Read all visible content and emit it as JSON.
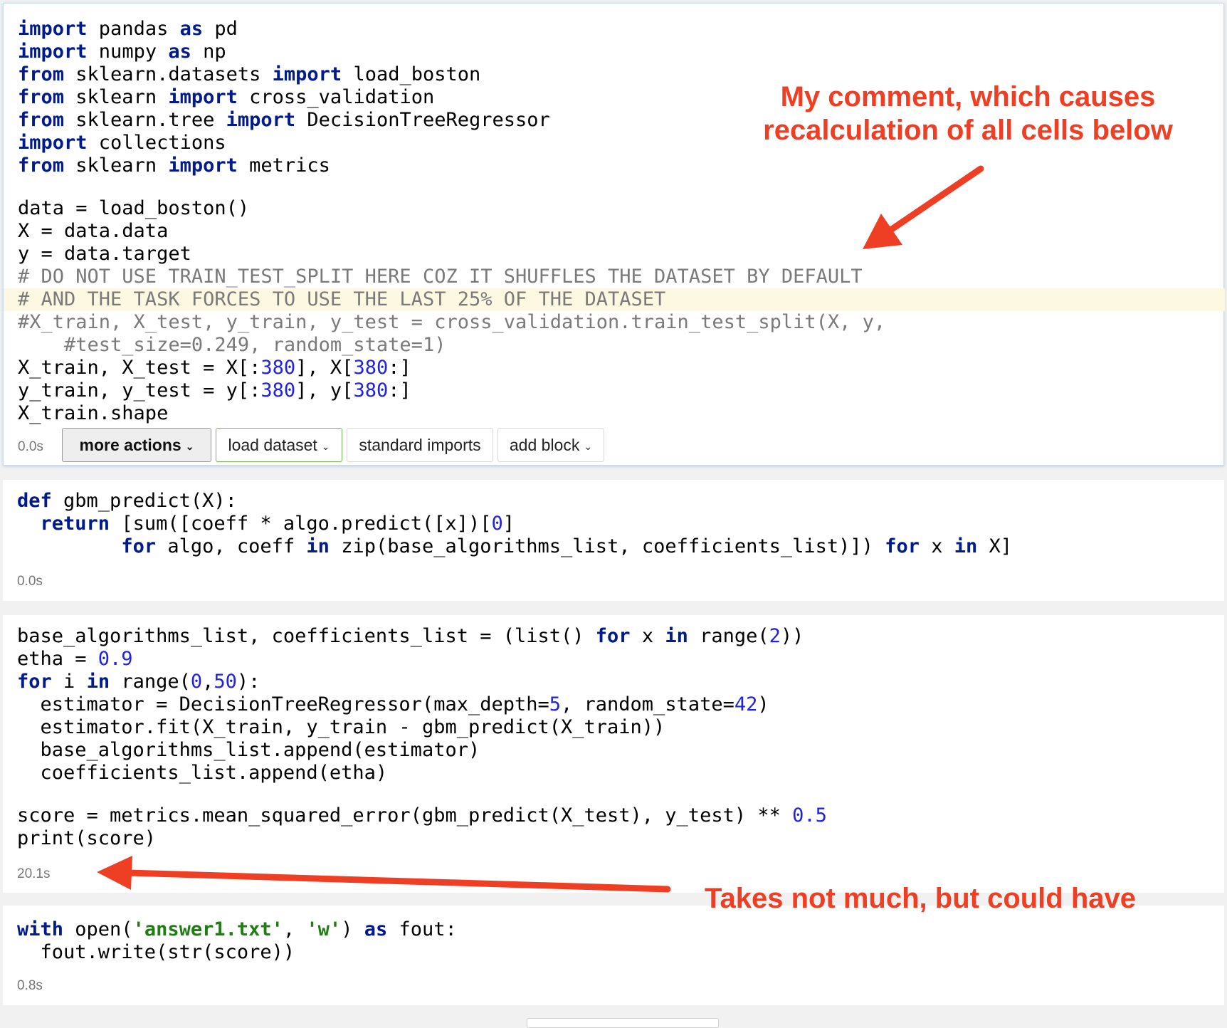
{
  "cells": [
    {
      "lines": [
        [
          [
            "kw",
            "import"
          ],
          [
            "",
            "  pandas "
          ],
          [
            "kw",
            "as"
          ],
          [
            "",
            "  pd"
          ]
        ],
        [
          [
            "kw",
            "import"
          ],
          [
            "",
            "  numpy "
          ],
          [
            "kw",
            "as"
          ],
          [
            "",
            "  np"
          ]
        ],
        [
          [
            "kw",
            "from"
          ],
          [
            "",
            "  sklearn.datasets "
          ],
          [
            "kw",
            "import"
          ],
          [
            "",
            "  load_boston"
          ]
        ],
        [
          [
            "kw",
            "from"
          ],
          [
            "",
            "  sklearn "
          ],
          [
            "kw",
            "import"
          ],
          [
            "",
            "  cross_validation"
          ]
        ],
        [
          [
            "kw",
            "from"
          ],
          [
            "",
            "  sklearn.tree "
          ],
          [
            "kw",
            "import"
          ],
          [
            "",
            "  DecisionTreeRegressor"
          ]
        ],
        [
          [
            "kw",
            "import"
          ],
          [
            "",
            "  collections"
          ]
        ],
        [
          [
            "kw",
            "from"
          ],
          [
            "",
            "  sklearn "
          ],
          [
            "kw",
            "import"
          ],
          [
            "",
            "  metrics"
          ]
        ],
        [],
        [
          [
            "",
            "data = load_boston()"
          ]
        ],
        [
          [
            "",
            "X = data.data"
          ]
        ],
        [
          [
            "",
            "y = data.target"
          ]
        ],
        [
          [
            "cm",
            "# DO NOT USE TRAIN_TEST_SPLIT HERE COZ IT SHUFFLES THE DATASET BY DEFAULT"
          ]
        ],
        [
          [
            "cm",
            "# AND THE TASK FORCES TO USE THE LAST 25% OF THE DATASET"
          ]
        ],
        [
          [
            "cm",
            "#X_train, X_test, y_train, y_test = cross_validation.train_test_split(X, y,"
          ]
        ],
        [
          [
            "cm",
            "        #test_size=0.249, random_state=1)"
          ]
        ],
        [
          [
            "",
            "X_train, X_test = X[:"
          ],
          [
            "num",
            "380"
          ],
          [
            "",
            "], X["
          ],
          [
            "num",
            "380"
          ],
          [
            "",
            ":]"
          ]
        ],
        [
          [
            "",
            "y_train, y_test = y[:"
          ],
          [
            "num",
            "380"
          ],
          [
            "",
            "], y["
          ],
          [
            "num",
            "380"
          ],
          [
            "",
            ":]"
          ]
        ],
        [
          [
            "",
            "X_train.shape"
          ]
        ]
      ],
      "time": "0.0s"
    },
    {
      "lines": [
        [
          [
            "kw",
            "def"
          ],
          [
            "",
            "  gbm_predict(X):"
          ]
        ],
        [
          [
            "",
            "    "
          ],
          [
            "kw",
            "return"
          ],
          [
            "",
            "  [sum([coeff * algo.predict([x])["
          ],
          [
            "num",
            "0"
          ],
          [
            "",
            "]"
          ]
        ],
        [
          [
            "",
            "                 "
          ],
          [
            "kw",
            "for"
          ],
          [
            "",
            "  algo, coeff "
          ],
          [
            "kw",
            "in"
          ],
          [
            "",
            "  zip(base_algorithms_list, coefficients_list)]) "
          ],
          [
            "kw",
            "for"
          ],
          [
            "",
            "  x "
          ],
          [
            "kw",
            "in"
          ],
          [
            "",
            "  X]"
          ]
        ]
      ],
      "time": "0.0s"
    },
    {
      "lines": [
        [
          [
            "",
            "base_algorithms_list, coefficients_list = (list() "
          ],
          [
            "kw",
            "for"
          ],
          [
            "",
            "  x "
          ],
          [
            "kw",
            "in"
          ],
          [
            "",
            "  range("
          ],
          [
            "num",
            "2"
          ],
          [
            "",
            "))"
          ]
        ],
        [
          [
            "",
            "etha = "
          ],
          [
            "num",
            "0.9"
          ]
        ],
        [
          [
            "kw",
            "for"
          ],
          [
            "",
            "  i "
          ],
          [
            "kw",
            "in"
          ],
          [
            "",
            "  range("
          ],
          [
            "num",
            "0"
          ],
          [
            "",
            ","
          ],
          [
            "num",
            "50"
          ],
          [
            "",
            "):"
          ]
        ],
        [
          [
            "",
            "    estimator = DecisionTreeRegressor(max_depth="
          ],
          [
            "num",
            "5"
          ],
          [
            "",
            ", random_state="
          ],
          [
            "num",
            "42"
          ],
          [
            "",
            ")"
          ]
        ],
        [
          [
            "",
            "    estimator.fit(X_train, y_train - gbm_predict(X_train))"
          ]
        ],
        [
          [
            "",
            "    base_algorithms_list.append(estimator)"
          ]
        ],
        [
          [
            "",
            "    coefficients_list.append(etha)"
          ]
        ],
        [],
        [
          [
            "",
            "score  = metrics.mean_squared_error(gbm_predict(X_test), y_test) ** "
          ],
          [
            "num",
            "0.5"
          ]
        ],
        [
          [
            "",
            "print(score)"
          ]
        ]
      ],
      "time": "20.1s"
    },
    {
      "lines": [
        [
          [
            "kw",
            "with"
          ],
          [
            "",
            "  open("
          ],
          [
            "str",
            "'answer1.txt'"
          ],
          [
            "",
            ", "
          ],
          [
            "str",
            "'w'"
          ],
          [
            "",
            ") "
          ],
          [
            "kw",
            "as"
          ],
          [
            "",
            "  fout:"
          ]
        ],
        [
          [
            "",
            "    fout.write(str(score))"
          ]
        ]
      ],
      "time": "0.8s"
    }
  ],
  "toolbar": {
    "more_actions": "more actions",
    "load_dataset": "load dataset",
    "standard_imports": "standard imports",
    "add_block": "add block",
    "caret": "⌄"
  },
  "annotations": {
    "comment_note": "My comment, which causes recalculation of all cells below",
    "timing_note": "Takes not much, but could have"
  },
  "colors": {
    "keyword": "#001b8c",
    "number": "#1e22e6",
    "string": "#1f7d12",
    "comment": "#7a7a7a",
    "annotation": "#ee3f24",
    "highlight_line": "#fdf8e2",
    "load_dataset_border": "#6cbd52"
  }
}
